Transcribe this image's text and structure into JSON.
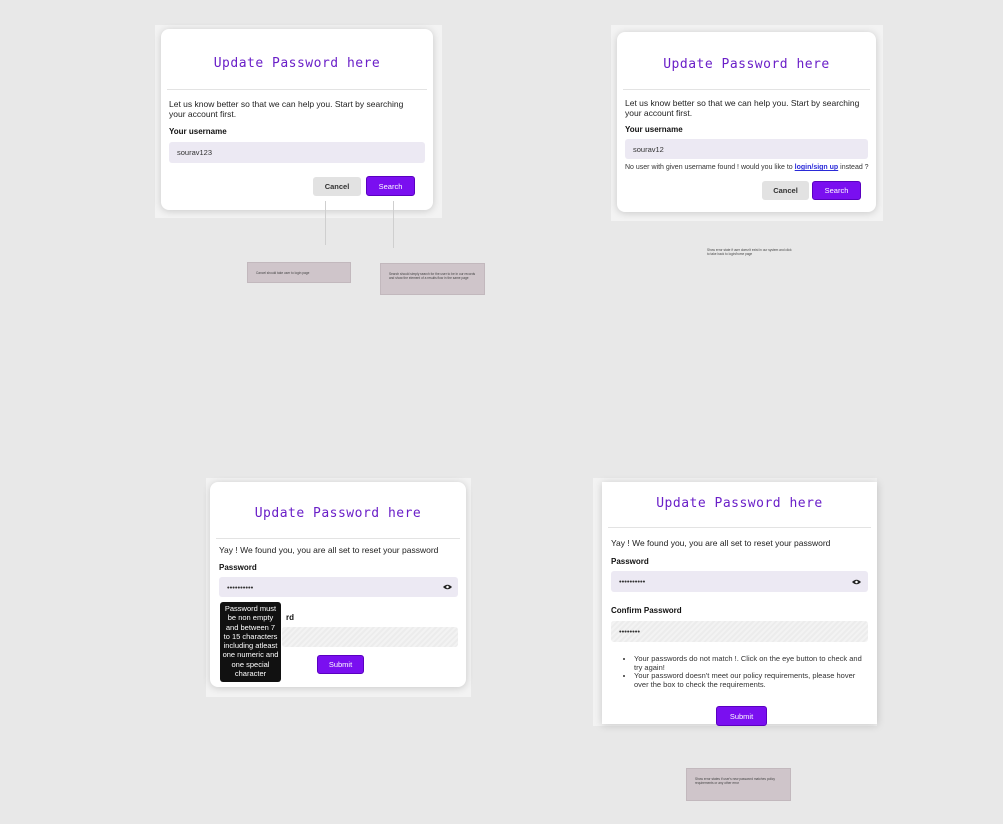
{
  "panel1": {
    "title": "Update Password here",
    "description": "Let us know better so that we can help you. Start by searching your account first.",
    "username_label": "Your username",
    "username_value": "sourav123",
    "cancel_label": "Cancel",
    "search_label": "Search"
  },
  "panel2": {
    "title": "Update Password here",
    "description": "Let us know better so that we can help you. Start by searching your account first.",
    "username_label": "Your username",
    "username_value": "sourav12",
    "error_prefix": "No user with given username found ! would you like to ",
    "error_link": "login/sign up",
    "error_suffix": " instead ?",
    "cancel_label": "Cancel",
    "search_label": "Search"
  },
  "panel3": {
    "title": "Update Password here",
    "message": "Yay ! We found you, you are all set to reset your password",
    "password_label": "Password",
    "password_value": "••••••••••",
    "confirm_label_partial": "rd",
    "tooltip": "Password must be non empty and between 7 to 15 characters including atleast one numeric and one special character",
    "submit_label": "Submit"
  },
  "panel4": {
    "title": "Update Password here",
    "message": "Yay ! We found you, you are all set to reset your password",
    "password_label": "Password",
    "password_value": "••••••••••",
    "confirm_label": "Confirm Password",
    "confirm_value": "••••••••",
    "errors": [
      "Your passwords do not match !. Click on the eye button to check and try again!",
      "Your password doesn't meet our policy requirements, please hover over the box to check the requirements."
    ],
    "submit_label": "Submit"
  },
  "notes": {
    "cancel_note": "Cancel should take user to login page",
    "search_note": "Search should simply search for the user to be in our records and show the element of a results flow in the same page",
    "error_note": "Show error state if user doesn't exist in our system and click to take back to login/home page",
    "bottom_note": "Show error states if user's new password matches policy requirements or any other error"
  },
  "colors": {
    "accent": "#7a0ff0",
    "title": "#6a1fc8",
    "note": "#cfc5ca"
  }
}
